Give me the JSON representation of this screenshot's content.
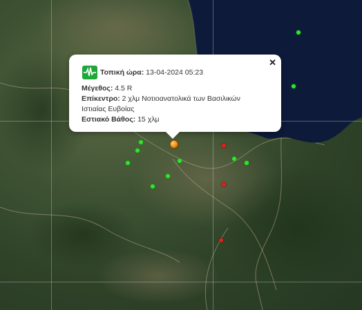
{
  "popup": {
    "time_label": "Τοπική ώρα:",
    "time_value": "13-04-2024 05:23",
    "magnitude_label": "Μέγεθος:",
    "magnitude_value": "4.5 R",
    "epicenter_label": "Επίκεντρο:",
    "epicenter_value_line1": "2 χλμ Νοτιοανατολικά των Βασιλικών",
    "epicenter_value_line2": "Ιστιαίας Ευβοίας",
    "depth_label": "Εστιακό Βάθος:",
    "depth_value": "15 χλμ",
    "close_glyph": "✕"
  },
  "colors": {
    "sea": "#0d1a3a",
    "green_marker": "#2fe62f",
    "red_marker": "#e22020",
    "main_marker": "#e48a10",
    "icon_bg": "#1fa83a"
  }
}
